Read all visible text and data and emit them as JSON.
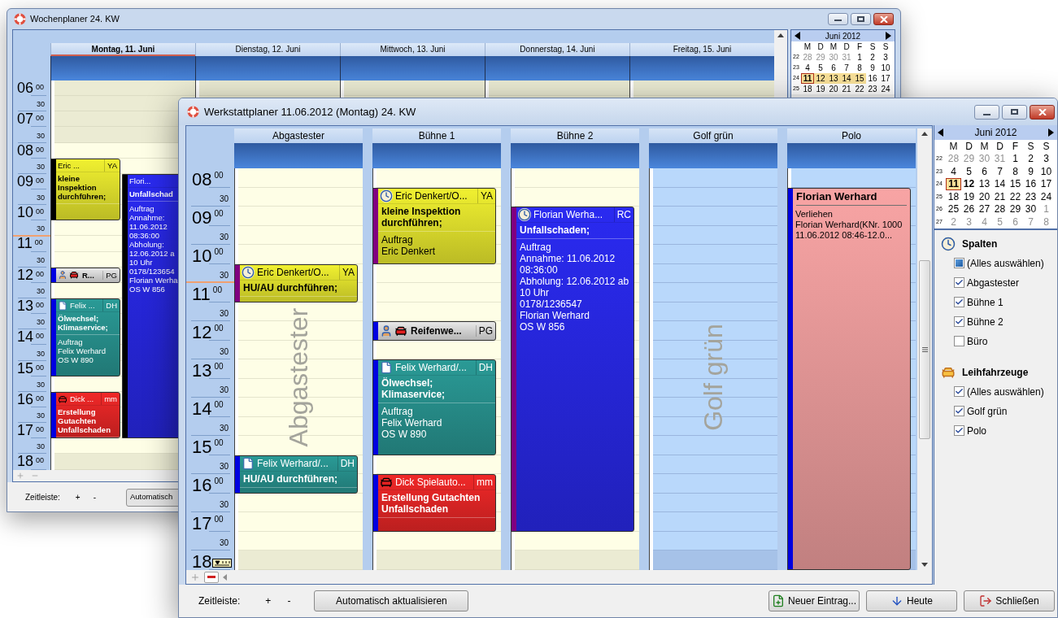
{
  "background_window": {
    "title": "Wochenplaner 24. KW",
    "days": [
      {
        "label": "Montag, 11. Juni",
        "selected": true,
        "appointments": [
          {
            "kind": "note",
            "title": "Eric ...",
            "tag": "YA",
            "subject": "kleine Inspektion durchführen;",
            "color": "#f0f030"
          },
          {
            "kind": "tires",
            "title": "R...",
            "tag": "PG",
            "color": "#e8e8e8"
          },
          {
            "kind": "order",
            "title": "Felix ...",
            "tag": "DH",
            "subject": "Ölwechsel; Klimaservice;",
            "details": [
              "Auftrag",
              "Felix Werhard",
              "OS W 890"
            ],
            "color": "#2a9a96"
          },
          {
            "kind": "damage",
            "title": "Dick ...",
            "tag": "mm",
            "subject": "Erstellung Gutachten Unfallschaden",
            "color": "#f02828"
          },
          {
            "kind": "note",
            "title": "Flori...",
            "subject": "Unfallschad",
            "details": [
              "Auftrag",
              "Annahme:",
              "11.06.2012",
              "08:36:00",
              "Abholung:",
              "12.06.2012 a",
              "10 Uhr",
              "0178/123654",
              "Florian Werha",
              "OS W 856"
            ],
            "color": "#2a2af0"
          }
        ]
      },
      {
        "label": "Dienstag, 12. Juni",
        "selected": false
      },
      {
        "label": "Mittwoch, 13. Juni",
        "selected": false
      },
      {
        "label": "Donnerstag, 14. Juni",
        "selected": false
      },
      {
        "label": "Freitag, 15. Juni",
        "selected": false
      }
    ],
    "hours": [
      {
        "hour": "06",
        "minute": "00",
        "half": "30"
      },
      {
        "hour": "07",
        "minute": "00",
        "half": "30"
      },
      {
        "hour": "08",
        "minute": "00",
        "half": "30"
      },
      {
        "hour": "09",
        "minute": "00",
        "half": "30"
      },
      {
        "hour": "10",
        "minute": "00",
        "half": "30"
      },
      {
        "hour": "11",
        "minute": "00",
        "half": "30"
      },
      {
        "hour": "12",
        "minute": "00",
        "half": "30"
      },
      {
        "hour": "13",
        "minute": "00",
        "half": "30"
      },
      {
        "hour": "14",
        "minute": "00",
        "half": "30"
      },
      {
        "hour": "15",
        "minute": "00",
        "half": "30"
      },
      {
        "hour": "16",
        "minute": "00",
        "half": "30"
      },
      {
        "hour": "17",
        "minute": "00",
        "half": "30"
      },
      {
        "hour": "18",
        "minute": "00"
      }
    ],
    "mini_calendar": {
      "month": "Juni 2012",
      "weekdays": [
        "M",
        "D",
        "M",
        "D",
        "F",
        "S",
        "S"
      ],
      "weeks": [
        {
          "week": "22",
          "days": [
            {
              "label": "28",
              "outside": true,
              "selected": false,
              "in_week": false
            },
            {
              "label": "29",
              "outside": true,
              "selected": false,
              "in_week": false
            },
            {
              "label": "30",
              "outside": true,
              "selected": false,
              "in_week": false
            },
            {
              "label": "31",
              "outside": true,
              "selected": false,
              "in_week": false
            },
            {
              "label": "1",
              "outside": false,
              "selected": false,
              "in_week": false
            },
            {
              "label": "2",
              "outside": false,
              "selected": false,
              "in_week": false
            },
            {
              "label": "3",
              "outside": false,
              "selected": false,
              "in_week": false
            }
          ]
        },
        {
          "week": "23",
          "days": [
            {
              "label": "4",
              "outside": false,
              "selected": false,
              "in_week": false
            },
            {
              "label": "5",
              "outside": false,
              "selected": false,
              "in_week": false
            },
            {
              "label": "6",
              "outside": false,
              "selected": false,
              "in_week": false
            },
            {
              "label": "7",
              "outside": false,
              "selected": false,
              "in_week": false
            },
            {
              "label": "8",
              "outside": false,
              "selected": false,
              "in_week": false
            },
            {
              "label": "9",
              "outside": false,
              "selected": false,
              "in_week": false
            },
            {
              "label": "10",
              "outside": false,
              "selected": false,
              "in_week": false
            }
          ]
        },
        {
          "week": "24",
          "days": [
            {
              "label": "11",
              "outside": false,
              "selected": true,
              "in_week": false
            },
            {
              "label": "12",
              "outside": false,
              "selected": false,
              "in_week": true
            },
            {
              "label": "13",
              "outside": false,
              "selected": false,
              "in_week": true
            },
            {
              "label": "14",
              "outside": false,
              "selected": false,
              "in_week": true
            },
            {
              "label": "15",
              "outside": false,
              "selected": false,
              "in_week": true
            },
            {
              "label": "16",
              "outside": false,
              "selected": false,
              "in_week": false
            },
            {
              "label": "17",
              "outside": false,
              "selected": false,
              "in_week": false
            }
          ]
        },
        {
          "week": "25",
          "days": [
            {
              "label": "18",
              "outside": false,
              "selected": false,
              "in_week": false
            },
            {
              "label": "19",
              "outside": false,
              "selected": false,
              "in_week": false
            },
            {
              "label": "20",
              "outside": false,
              "selected": false,
              "in_week": false
            },
            {
              "label": "21",
              "outside": false,
              "selected": false,
              "in_week": false
            },
            {
              "label": "22",
              "outside": false,
              "selected": false,
              "in_week": false
            },
            {
              "label": "23",
              "outside": false,
              "selected": false,
              "in_week": false
            },
            {
              "label": "24",
              "outside": false,
              "selected": false,
              "in_week": false
            }
          ]
        }
      ]
    },
    "bottom_bar": {
      "timeline_label": "Zeitleiste:",
      "zoom_in": "+",
      "zoom_out": "-",
      "refresh_button": "Automatisch"
    }
  },
  "main_window": {
    "title": "Werkstattplaner 11.06.2012 (Montag) 24. KW",
    "columns": [
      {
        "name": "Abgastester",
        "kind": "workshop",
        "watermark": "Abgastester",
        "appointments": [
          {
            "kind": "scheduled",
            "title": "Eric Denkert/O...",
            "tag": "YA",
            "subject": "HU/AU durchführen;",
            "color": "#f0f030"
          },
          {
            "kind": "order",
            "title": "Felix Werhard/...",
            "tag": "DH",
            "subject": "HU/AU durchführen;",
            "color": "#2a9a96"
          }
        ]
      },
      {
        "name": "Bühne 1",
        "kind": "workshop",
        "appointments": [
          {
            "kind": "scheduled",
            "title": "Eric Denkert/O...",
            "tag": "YA",
            "subject": "kleine Inspektion durchführen;",
            "details": [
              "Auftrag",
              "Eric Denkert"
            ],
            "color": "#f0f030"
          },
          {
            "kind": "tires",
            "title": "Reifenwe...",
            "tag": "PG",
            "color": "#e8e8e8"
          },
          {
            "kind": "order",
            "title": "Felix Werhard/...",
            "tag": "DH",
            "subject": "Ölwechsel; Klimaservice;",
            "details": [
              "Auftrag",
              "Felix Werhard",
              "OS W 890"
            ],
            "color": "#2a9a96"
          },
          {
            "kind": "damage",
            "title": "Dick Spielauto...",
            "tag": "mm",
            "subject": "Erstellung Gutachten Unfallschaden",
            "color": "#f02828"
          }
        ]
      },
      {
        "name": "Bühne 2",
        "kind": "workshop",
        "appointments": [
          {
            "kind": "scheduled",
            "title": "Florian Werha...",
            "tag": "RC",
            "subject": "Unfallschaden;",
            "details": [
              "Auftrag",
              "Annahme: 11.06.2012 08:36:00",
              "Abholung: 12.06.2012 ab 10 Uhr",
              "0178/1236547",
              "Florian Werhard",
              "OS W 856"
            ],
            "color": "#2a2af0"
          }
        ]
      },
      {
        "name": "Golf grün",
        "kind": "vehicle",
        "watermark": "Golf grün"
      },
      {
        "name": "Polo",
        "kind": "vehicle",
        "appointments": [
          {
            "kind": "loan",
            "title": "Florian Werhard",
            "details": [
              "Verliehen",
              "Florian Werhard(KNr. 1000",
              "11.06.2012 08:46-12.0..."
            ],
            "color": "#f8a4a4"
          }
        ]
      }
    ],
    "hours": [
      {
        "hour": "08",
        "minute": "00",
        "half": "30"
      },
      {
        "hour": "09",
        "minute": "00",
        "half": "30"
      },
      {
        "hour": "10",
        "minute": "00",
        "half": "30"
      },
      {
        "hour": "11",
        "minute": "00",
        "half": "30"
      },
      {
        "hour": "12",
        "minute": "00",
        "half": "30"
      },
      {
        "hour": "13",
        "minute": "00",
        "half": "30"
      },
      {
        "hour": "14",
        "minute": "00",
        "half": "30"
      },
      {
        "hour": "15",
        "minute": "00",
        "half": "30"
      },
      {
        "hour": "16",
        "minute": "00",
        "half": "30"
      },
      {
        "hour": "17",
        "minute": "00",
        "half": "30"
      },
      {
        "hour": "18"
      }
    ],
    "mini_calendar": {
      "month": "Juni 2012",
      "weekdays": [
        "M",
        "D",
        "M",
        "D",
        "F",
        "S",
        "S"
      ],
      "weeks": [
        {
          "week": "22",
          "days": [
            {
              "label": "28",
              "outside": true,
              "selected": false,
              "today": false
            },
            {
              "label": "29",
              "outside": true,
              "selected": false,
              "today": false
            },
            {
              "label": "30",
              "outside": true,
              "selected": false,
              "today": false
            },
            {
              "label": "31",
              "outside": true,
              "selected": false,
              "today": false
            },
            {
              "label": "1",
              "outside": false,
              "selected": false,
              "today": false
            },
            {
              "label": "2",
              "outside": false,
              "selected": false,
              "today": false
            },
            {
              "label": "3",
              "outside": false,
              "selected": false,
              "today": false
            }
          ]
        },
        {
          "week": "23",
          "days": [
            {
              "label": "4",
              "outside": false,
              "selected": false,
              "today": false
            },
            {
              "label": "5",
              "outside": false,
              "selected": false,
              "today": false
            },
            {
              "label": "6",
              "outside": false,
              "selected": false,
              "today": false
            },
            {
              "label": "7",
              "outside": false,
              "selected": false,
              "today": false
            },
            {
              "label": "8",
              "outside": false,
              "selected": false,
              "today": false
            },
            {
              "label": "9",
              "outside": false,
              "selected": false,
              "today": false
            },
            {
              "label": "10",
              "outside": false,
              "selected": false,
              "today": false
            }
          ]
        },
        {
          "week": "24",
          "days": [
            {
              "label": "11",
              "outside": false,
              "selected": true,
              "today": false
            },
            {
              "label": "12",
              "outside": false,
              "selected": false,
              "today": true
            },
            {
              "label": "13",
              "outside": false,
              "selected": false,
              "today": false
            },
            {
              "label": "14",
              "outside": false,
              "selected": false,
              "today": false
            },
            {
              "label": "15",
              "outside": false,
              "selected": false,
              "today": false
            },
            {
              "label": "16",
              "outside": false,
              "selected": false,
              "today": false
            },
            {
              "label": "17",
              "outside": false,
              "selected": false,
              "today": false
            }
          ]
        },
        {
          "week": "25",
          "days": [
            {
              "label": "18",
              "outside": false,
              "selected": false,
              "today": false
            },
            {
              "label": "19",
              "outside": false,
              "selected": false,
              "today": false
            },
            {
              "label": "20",
              "outside": false,
              "selected": false,
              "today": false
            },
            {
              "label": "21",
              "outside": false,
              "selected": false,
              "today": false
            },
            {
              "label": "22",
              "outside": false,
              "selected": false,
              "today": false
            },
            {
              "label": "23",
              "outside": false,
              "selected": false,
              "today": false
            },
            {
              "label": "24",
              "outside": false,
              "selected": false,
              "today": false
            }
          ]
        },
        {
          "week": "26",
          "days": [
            {
              "label": "25",
              "outside": false,
              "selected": false,
              "today": false
            },
            {
              "label": "26",
              "outside": false,
              "selected": false,
              "today": false
            },
            {
              "label": "27",
              "outside": false,
              "selected": false,
              "today": false
            },
            {
              "label": "28",
              "outside": false,
              "selected": false,
              "today": false
            },
            {
              "label": "29",
              "outside": false,
              "selected": false,
              "today": false
            },
            {
              "label": "30",
              "outside": false,
              "selected": false,
              "today": false
            },
            {
              "label": "1",
              "outside": true,
              "selected": false,
              "today": false
            }
          ]
        },
        {
          "week": "27",
          "days": [
            {
              "label": "2",
              "outside": true,
              "selected": false,
              "today": false
            },
            {
              "label": "3",
              "outside": true,
              "selected": false,
              "today": false
            },
            {
              "label": "4",
              "outside": true,
              "selected": false,
              "today": false
            },
            {
              "label": "5",
              "outside": true,
              "selected": false,
              "today": false
            },
            {
              "label": "6",
              "outside": true,
              "selected": false,
              "today": false
            },
            {
              "label": "7",
              "outside": true,
              "selected": false,
              "today": false
            },
            {
              "label": "8",
              "outside": true,
              "selected": false,
              "today": false
            }
          ]
        }
      ]
    },
    "filters": [
      {
        "title": "Spalten",
        "items": [
          {
            "label": "(Alles auswählen)",
            "checked": false,
            "indeterminate": true
          },
          {
            "label": "Abgastester",
            "checked": true,
            "indeterminate": false
          },
          {
            "label": "Bühne 1",
            "checked": true,
            "indeterminate": false
          },
          {
            "label": "Bühne 2",
            "checked": true,
            "indeterminate": false
          },
          {
            "label": "Büro",
            "checked": false,
            "indeterminate": false
          }
        ]
      },
      {
        "title": "Leihfahrzeuge",
        "items": [
          {
            "label": "(Alles auswählen)",
            "checked": true,
            "indeterminate": false
          },
          {
            "label": "Golf grün",
            "checked": true,
            "indeterminate": false
          },
          {
            "label": "Polo",
            "checked": true,
            "indeterminate": false
          }
        ]
      }
    ],
    "bottom_bar": {
      "timeline_label": "Zeitleiste:",
      "zoom_in": "+",
      "zoom_out": "-",
      "refresh_button": "Automatisch aktualisieren",
      "buttons": [
        "Neuer Eintrag...",
        "Heute",
        "Schließen"
      ]
    }
  }
}
